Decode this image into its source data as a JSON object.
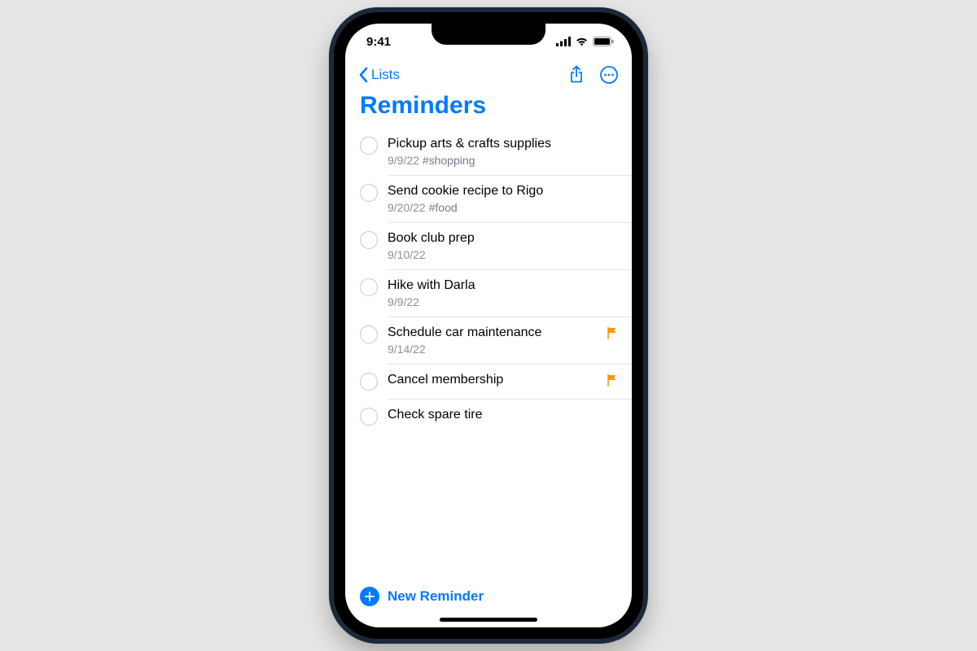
{
  "status": {
    "time": "9:41"
  },
  "nav": {
    "back_label": "Lists"
  },
  "title": "Reminders",
  "reminders": [
    {
      "title": "Pickup arts & crafts supplies",
      "date": "9/9/22",
      "tag": "#shopping",
      "flag": false
    },
    {
      "title": "Send cookie recipe to Rigo",
      "date": "9/20/22",
      "tag": "#food",
      "flag": false
    },
    {
      "title": "Book club prep",
      "date": "9/10/22",
      "tag": "",
      "flag": false
    },
    {
      "title": "Hike with Darla",
      "date": "9/9/22",
      "tag": "",
      "flag": false
    },
    {
      "title": "Schedule car maintenance",
      "date": "9/14/22",
      "tag": "",
      "flag": true
    },
    {
      "title": "Cancel membership",
      "date": "",
      "tag": "",
      "flag": true
    },
    {
      "title": "Check spare tire",
      "date": "",
      "tag": "",
      "flag": false
    }
  ],
  "footer": {
    "new_label": "New Reminder"
  }
}
